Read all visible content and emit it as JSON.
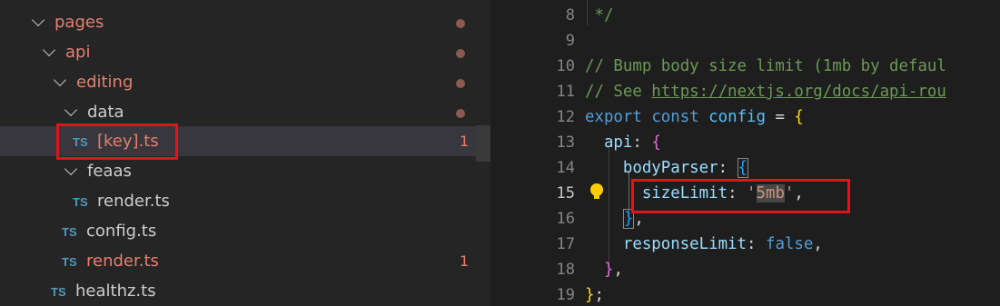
{
  "explorer": {
    "items": [
      {
        "label": "pages",
        "type": "folder",
        "modified": true
      },
      {
        "label": "api",
        "type": "folder",
        "modified": true
      },
      {
        "label": "editing",
        "type": "folder",
        "modified": true
      },
      {
        "label": "data",
        "type": "folder",
        "modified": true
      },
      {
        "label": "[key].ts",
        "type": "ts-file",
        "badge": "TS",
        "problems": "1",
        "selected": true
      },
      {
        "label": "feaas",
        "type": "folder"
      },
      {
        "label": "render.ts",
        "type": "ts-file",
        "badge": "TS"
      },
      {
        "label": "config.ts",
        "type": "ts-file",
        "badge": "TS"
      },
      {
        "label": "render.ts",
        "type": "ts-file",
        "badge": "TS",
        "problems": "1"
      },
      {
        "label": "healthz.ts",
        "type": "ts-file",
        "badge": "TS"
      }
    ]
  },
  "editor": {
    "active_line": "15",
    "lines": [
      {
        "num": "8",
        "tokens": [
          {
            "t": " */",
            "c": "c-com"
          }
        ]
      },
      {
        "num": "9",
        "tokens": []
      },
      {
        "num": "10",
        "tokens": [
          {
            "t": "// Bump body size limit (1mb by defaul",
            "c": "c-com"
          }
        ]
      },
      {
        "num": "11",
        "tokens": [
          {
            "t": "// See ",
            "c": "c-com"
          },
          {
            "t": "https://nextjs.org/docs/api-rou",
            "c": "c-link"
          }
        ]
      },
      {
        "num": "12",
        "tokens": [
          {
            "t": "export",
            "c": "c-kw"
          },
          {
            "t": " "
          },
          {
            "t": "const",
            "c": "c-kw"
          },
          {
            "t": " "
          },
          {
            "t": "config",
            "c": "c-var"
          },
          {
            "t": " = "
          },
          {
            "t": "{",
            "c": "c-b1"
          }
        ]
      },
      {
        "num": "13",
        "tokens": [
          {
            "t": "  "
          },
          {
            "t": "api",
            "c": "c-prop"
          },
          {
            "t": ": "
          },
          {
            "t": "{",
            "c": "c-b2"
          }
        ]
      },
      {
        "num": "14",
        "tokens": [
          {
            "t": "    "
          },
          {
            "t": "bodyParser",
            "c": "c-prop"
          },
          {
            "t": ": "
          },
          {
            "t": "{",
            "c": "c-b3 bracket-box"
          }
        ]
      },
      {
        "num": "15",
        "tokens": [
          {
            "t": "      "
          },
          {
            "t": "sizeLimit",
            "c": "c-prop"
          },
          {
            "t": ": "
          },
          {
            "t": "'",
            "c": "c-str"
          },
          {
            "t": "5mb",
            "c": "c-str match"
          },
          {
            "t": "'",
            "c": "c-str"
          },
          {
            "t": ","
          }
        ]
      },
      {
        "num": "16",
        "tokens": [
          {
            "t": "    "
          },
          {
            "t": "}",
            "c": "c-b3 bracket-box"
          },
          {
            "t": ","
          }
        ]
      },
      {
        "num": "17",
        "tokens": [
          {
            "t": "    "
          },
          {
            "t": "responseLimit",
            "c": "c-prop"
          },
          {
            "t": ": "
          },
          {
            "t": "false",
            "c": "c-kw"
          },
          {
            "t": ","
          }
        ]
      },
      {
        "num": "18",
        "tokens": [
          {
            "t": "  "
          },
          {
            "t": "}",
            "c": "c-b2"
          },
          {
            "t": ","
          }
        ]
      },
      {
        "num": "19",
        "tokens": [
          {
            "t": "}",
            "c": "c-b1"
          },
          {
            "t": ";"
          }
        ]
      }
    ]
  },
  "colors": {
    "highlight_box": "#e0141c",
    "modified_text": "#e2806f",
    "ts_badge": "#519aba",
    "lightbulb": "#ffcc00"
  }
}
